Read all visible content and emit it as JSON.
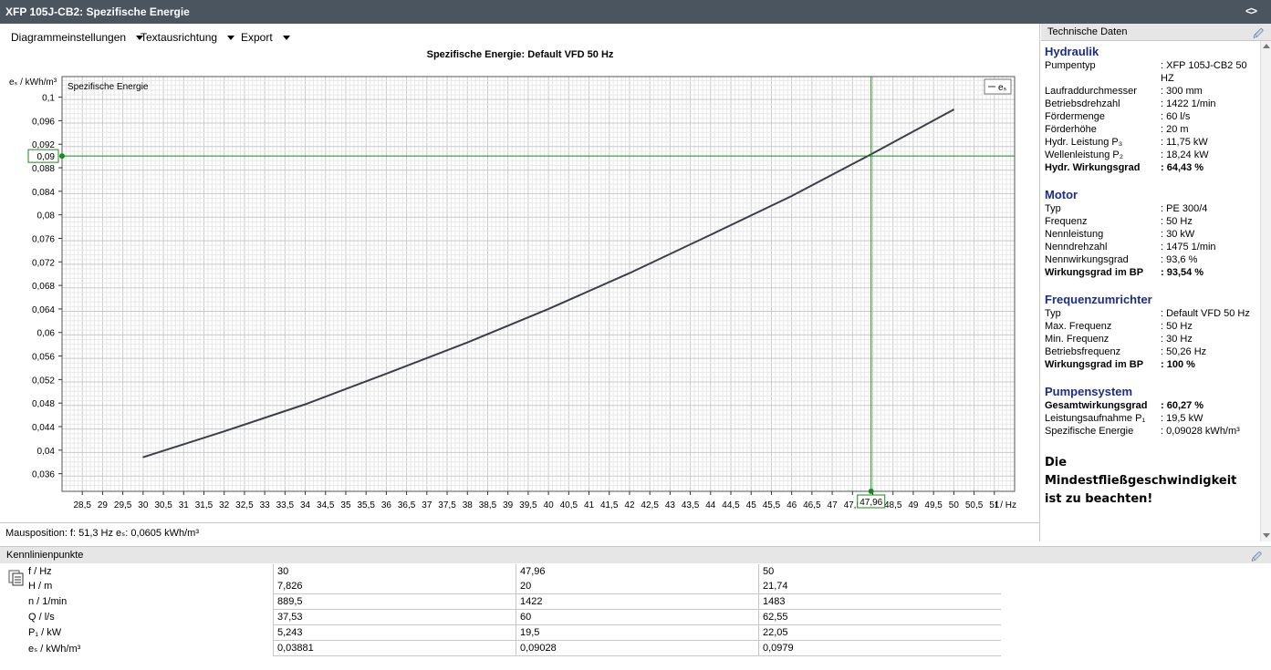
{
  "window": {
    "title": "XFP 105J-CB2: Spezifische Energie",
    "title_icon": "code-brackets-icon"
  },
  "menu": [
    "Diagrammeinstellungen",
    "Textausrichtung",
    "Export"
  ],
  "chart_title": "Spezifische Energie: Default VFD 50 Hz",
  "mouse_position": "Mausposition:  f: 51,3 Hz  eₛ: 0,0605 kWh/m³",
  "chart_data": {
    "type": "line",
    "title": "Spezifische Energie: Default VFD 50 Hz",
    "inner_label": "Spezifische Energie",
    "xlabel": "f / Hz",
    "ylabel": "eₛ / kWh/m³",
    "xlim": [
      28,
      51.5
    ],
    "ylim": [
      0.033,
      0.1035
    ],
    "x_ticks": [
      "28,5",
      "29",
      "29,5",
      "30",
      "30,5",
      "31",
      "31,5",
      "32",
      "32,5",
      "33",
      "33,5",
      "34",
      "34,5",
      "35",
      "35,5",
      "36",
      "36,5",
      "37",
      "37,5",
      "38",
      "38,5",
      "39",
      "39,5",
      "40",
      "40,5",
      "41",
      "41,5",
      "42",
      "42,5",
      "43",
      "43,5",
      "44",
      "44,5",
      "45",
      "45,5",
      "46",
      "46,5",
      "47",
      "47,5",
      "48",
      "48,5",
      "49",
      "49,5",
      "50",
      "50,5",
      "51"
    ],
    "y_ticks": [
      "0,036",
      "0,04",
      "0,044",
      "0,048",
      "0,052",
      "0,056",
      "0,06",
      "0,064",
      "0,068",
      "0,072",
      "0,076",
      "0,08",
      "0,084",
      "0,088",
      "0,092",
      "0,096",
      "0,1"
    ],
    "legend": "eₛ",
    "legend_position": "top-right",
    "grid": true,
    "series": [
      {
        "name": "eₛ",
        "x": [
          30,
          32,
          34,
          36,
          38,
          40,
          42,
          44,
          46,
          47.96,
          50
        ],
        "y": [
          0.0388,
          0.0432,
          0.0478,
          0.053,
          0.0583,
          0.064,
          0.0701,
          0.0766,
          0.0832,
          0.0903,
          0.0979
        ]
      }
    ],
    "crosshair": {
      "x": 47.96,
      "y": 0.09,
      "x_label": "47,96",
      "y_label": "0,09"
    },
    "line_color": "#3a3f4a",
    "crosshair_color": "#1a8a1a"
  },
  "technical_data": {
    "header": "Technische Daten",
    "sections": [
      {
        "title": "Hydraulik",
        "rows": [
          {
            "k": "Pumpentyp",
            "v": ": XFP 105J-CB2  50 HZ",
            "wrap": true
          },
          {
            "k": "Laufraddurchmesser",
            "v": ": 300 mm"
          },
          {
            "k": "Betriebsdrehzahl",
            "v": ": 1422 1/min"
          },
          {
            "k": "Fördermenge",
            "v": ": 60 l/s"
          },
          {
            "k": "Förderhöhe",
            "v": ": 20 m"
          },
          {
            "k": "Hydr. Leistung P₃",
            "v": ": 11,75 kW"
          },
          {
            "k": "Wellenleistung P₂",
            "v": ": 18,24 kW"
          },
          {
            "k": "Hydr. Wirkungsgrad",
            "v": ": 64,43 %",
            "bold": true
          }
        ]
      },
      {
        "title": "Motor",
        "rows": [
          {
            "k": "Typ",
            "v": ": PE 300/4"
          },
          {
            "k": "Frequenz",
            "v": ": 50 Hz"
          },
          {
            "k": "Nennleistung",
            "v": ": 30 kW"
          },
          {
            "k": "Nenndrehzahl",
            "v": ": 1475 1/min"
          },
          {
            "k": "Nennwirkungsgrad",
            "v": ": 93,6 %"
          },
          {
            "k": "Wirkungsgrad im BP",
            "v": ": 93,54 %",
            "bold": true
          }
        ]
      },
      {
        "title": "Frequenzumrichter",
        "rows": [
          {
            "k": "Typ",
            "v": ": Default VFD 50 Hz"
          },
          {
            "k": "Max. Frequenz",
            "v": ": 50 Hz"
          },
          {
            "k": "Min. Frequenz",
            "v": ": 30 Hz"
          },
          {
            "k": "Betriebsfrequenz",
            "v": ": 50,26 Hz"
          },
          {
            "k": "Wirkungsgrad im BP",
            "v": ": 100 %",
            "bold": true
          }
        ]
      },
      {
        "title": "Pumpensystem",
        "rows": [
          {
            "k": "Gesamtwirkungsgrad",
            "v": ": 60,27 %",
            "bold": true
          },
          {
            "k": "Leistungsaufnahme P₁",
            "v": ": 19,5 kW"
          },
          {
            "k": "Spezifische Energie",
            "v": ": 0,09028 kWh/m³"
          }
        ]
      }
    ],
    "note": "Die Mindestfließgeschwindigkeit ist zu beachten!"
  },
  "kennlinienpunkte": {
    "header": "Kennlinienpunkte",
    "rows": [
      {
        "label": "f / Hz",
        "values": [
          "30",
          "47,96",
          "50"
        ]
      },
      {
        "label": "H / m",
        "values": [
          "7,826",
          "20",
          "21,74"
        ]
      },
      {
        "label": "n / 1/min",
        "values": [
          "889,5",
          "1422",
          "1483"
        ]
      },
      {
        "label": "Q / l/s",
        "values": [
          "37,53",
          "60",
          "62,55"
        ]
      },
      {
        "label": "P₁ / kW",
        "values": [
          "5,243",
          "19,5",
          "22,05"
        ]
      },
      {
        "label": "eₛ / kWh/m³",
        "values": [
          "0,03881",
          "0,09028",
          "0,0979"
        ]
      }
    ]
  }
}
